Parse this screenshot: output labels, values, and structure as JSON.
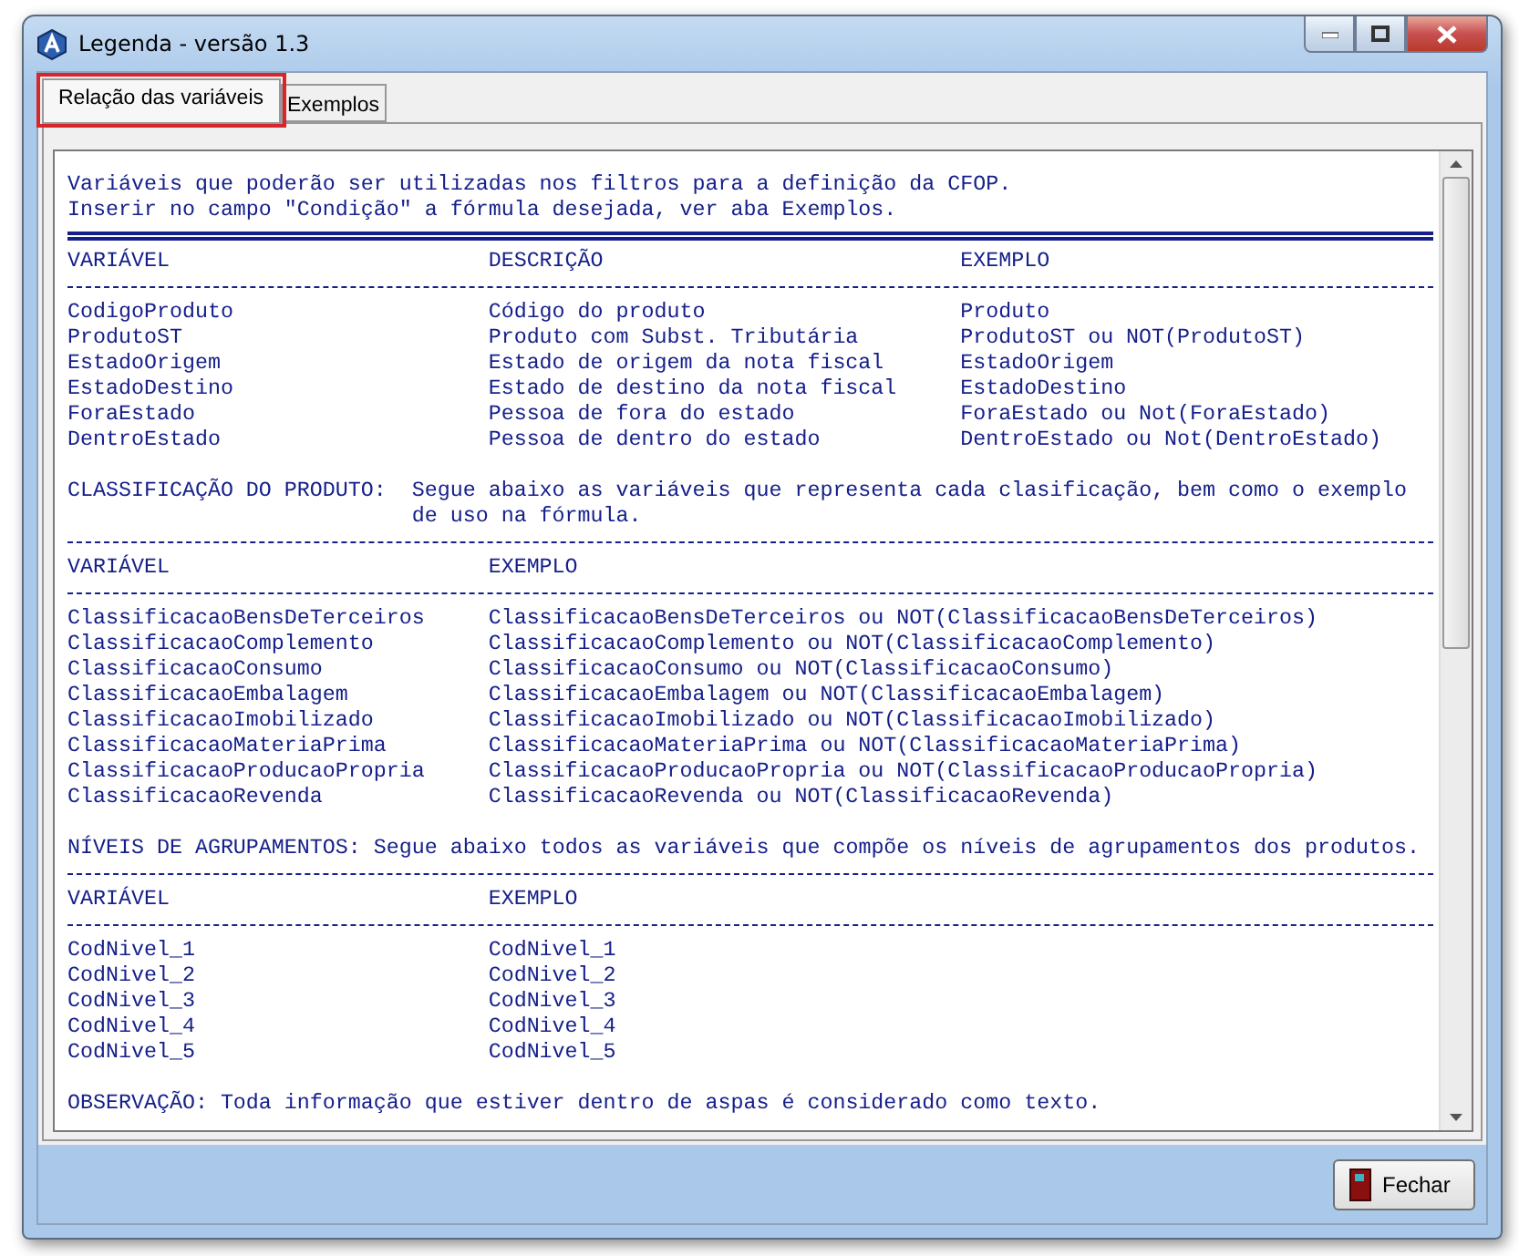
{
  "window": {
    "title": "Legenda - versão 1.3"
  },
  "tabs": [
    {
      "label": "Relação das variáveis",
      "selected": true
    },
    {
      "label": "Exemplos",
      "selected": false
    }
  ],
  "intro": [
    "Variáveis que poderão ser utilizadas nos filtros para a definição da CFOP.",
    "Inserir no campo \"Condição\" a fórmula desejada, ver aba Exemplos."
  ],
  "variables_table": {
    "columns": [
      "VARIÁVEL",
      "DESCRIÇÃO",
      "EXEMPLO"
    ],
    "rows": [
      [
        "CodigoProduto",
        "Código do produto",
        "Produto"
      ],
      [
        "ProdutoST",
        "Produto com Subst. Tributária",
        "ProdutoST ou NOT(ProdutoST)"
      ],
      [
        "EstadoOrigem",
        "Estado de origem da nota fiscal",
        "EstadoOrigem"
      ],
      [
        "EstadoDestino",
        "Estado de destino da nota fiscal",
        "EstadoDestino"
      ],
      [
        "ForaEstado",
        "Pessoa de fora do estado",
        "ForaEstado ou Not(ForaEstado)"
      ],
      [
        "DentroEstado",
        "Pessoa de dentro do estado",
        "DentroEstado ou Not(DentroEstado)"
      ]
    ]
  },
  "classification_section": {
    "heading": "CLASSIFICAÇÃO DO PRODUTO:",
    "text": "Segue abaixo as variáveis que representa cada clasificação, bem como o exemplo de uso na fórmula."
  },
  "classification_table": {
    "columns": [
      "VARIÁVEL",
      "EXEMPLO"
    ],
    "rows": [
      [
        "ClassificacaoBensDeTerceiros",
        "ClassificacaoBensDeTerceiros ou NOT(ClassificacaoBensDeTerceiros)"
      ],
      [
        "ClassificacaoComplemento",
        "ClassificacaoComplemento ou NOT(ClassificacaoComplemento)"
      ],
      [
        "ClassificacaoConsumo",
        "ClassificacaoConsumo ou NOT(ClassificacaoConsumo)"
      ],
      [
        "ClassificacaoEmbalagem",
        "ClassificacaoEmbalagem ou NOT(ClassificacaoEmbalagem)"
      ],
      [
        "ClassificacaoImobilizado",
        "ClassificacaoImobilizado ou NOT(ClassificacaoImobilizado)"
      ],
      [
        "ClassificacaoMateriaPrima",
        "ClassificacaoMateriaPrima ou NOT(ClassificacaoMateriaPrima)"
      ],
      [
        "ClassificacaoProducaoPropria",
        "ClassificacaoProducaoPropria ou NOT(ClassificacaoProducaoPropria)"
      ],
      [
        "ClassificacaoRevenda",
        "ClassificacaoRevenda ou NOT(ClassificacaoRevenda)"
      ]
    ]
  },
  "levels_section": {
    "heading": "NÍVEIS DE AGRUPAMENTOS:",
    "text": "Segue abaixo todos as variáveis que compõe os níveis de agrupamentos dos produtos."
  },
  "levels_table": {
    "columns": [
      "VARIÁVEL",
      "EXEMPLO"
    ],
    "rows": [
      [
        "CodNivel_1",
        "CodNivel_1"
      ],
      [
        "CodNivel_2",
        "CodNivel_2"
      ],
      [
        "CodNivel_3",
        "CodNivel_3"
      ],
      [
        "CodNivel_4",
        "CodNivel_4"
      ],
      [
        "CodNivel_5",
        "CodNivel_5"
      ]
    ]
  },
  "note": "OBSERVAÇÃO: Toda informação que estiver dentro de aspas é considerado como texto.",
  "buttons": [
    {
      "label": "Fechar"
    }
  ]
}
